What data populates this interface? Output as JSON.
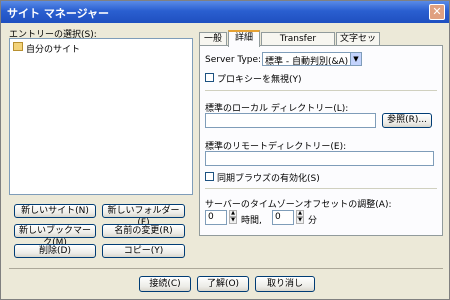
{
  "window": {
    "title": "サイト マネージャー"
  },
  "left": {
    "entry_label": "エントリーの選択(S):",
    "tree_items": [
      "自分のサイト"
    ]
  },
  "buttons": {
    "new_site": "新しいサイト(N)",
    "new_folder": "新しいフォルダー(F)",
    "new_bookmark": "新しいブックマーク(M)",
    "rename": "名前の変更(R)",
    "delete": "削除(D)",
    "copy": "コピー(Y)"
  },
  "tabs": [
    "一般",
    "詳細",
    "Transfer Settings",
    "文字セット"
  ],
  "active_tab": "詳細",
  "details": {
    "server_type_label": "Server Type:",
    "server_type_value": "標準 - 自動判別(&A)",
    "proxy_bypass": "プロキシーを無視(Y)",
    "proxy_bypass_checked": false,
    "local_dir_label": "標準のローカル ディレクトリー(L):",
    "local_dir_value": "",
    "browse": "参照(R)...",
    "remote_dir_label": "標準のリモートディレクトリー(E):",
    "remote_dir_value": "",
    "sync_browse": "同期ブラウズの有効化(S)",
    "sync_browse_checked": false,
    "tz_label": "サーバーのタイムゾーンオフセットの調整(A):",
    "hours_value": "0",
    "hours_label": "時間,",
    "minutes_value": "0",
    "minutes_label": "分"
  },
  "footer": {
    "connect": "接続(C)",
    "ok": "了解(O)",
    "cancel": "取り消し"
  },
  "colors": {
    "titlebar": "#2a5fd0",
    "close_button": "#e0a080",
    "tab_accent": "#e6a233"
  }
}
